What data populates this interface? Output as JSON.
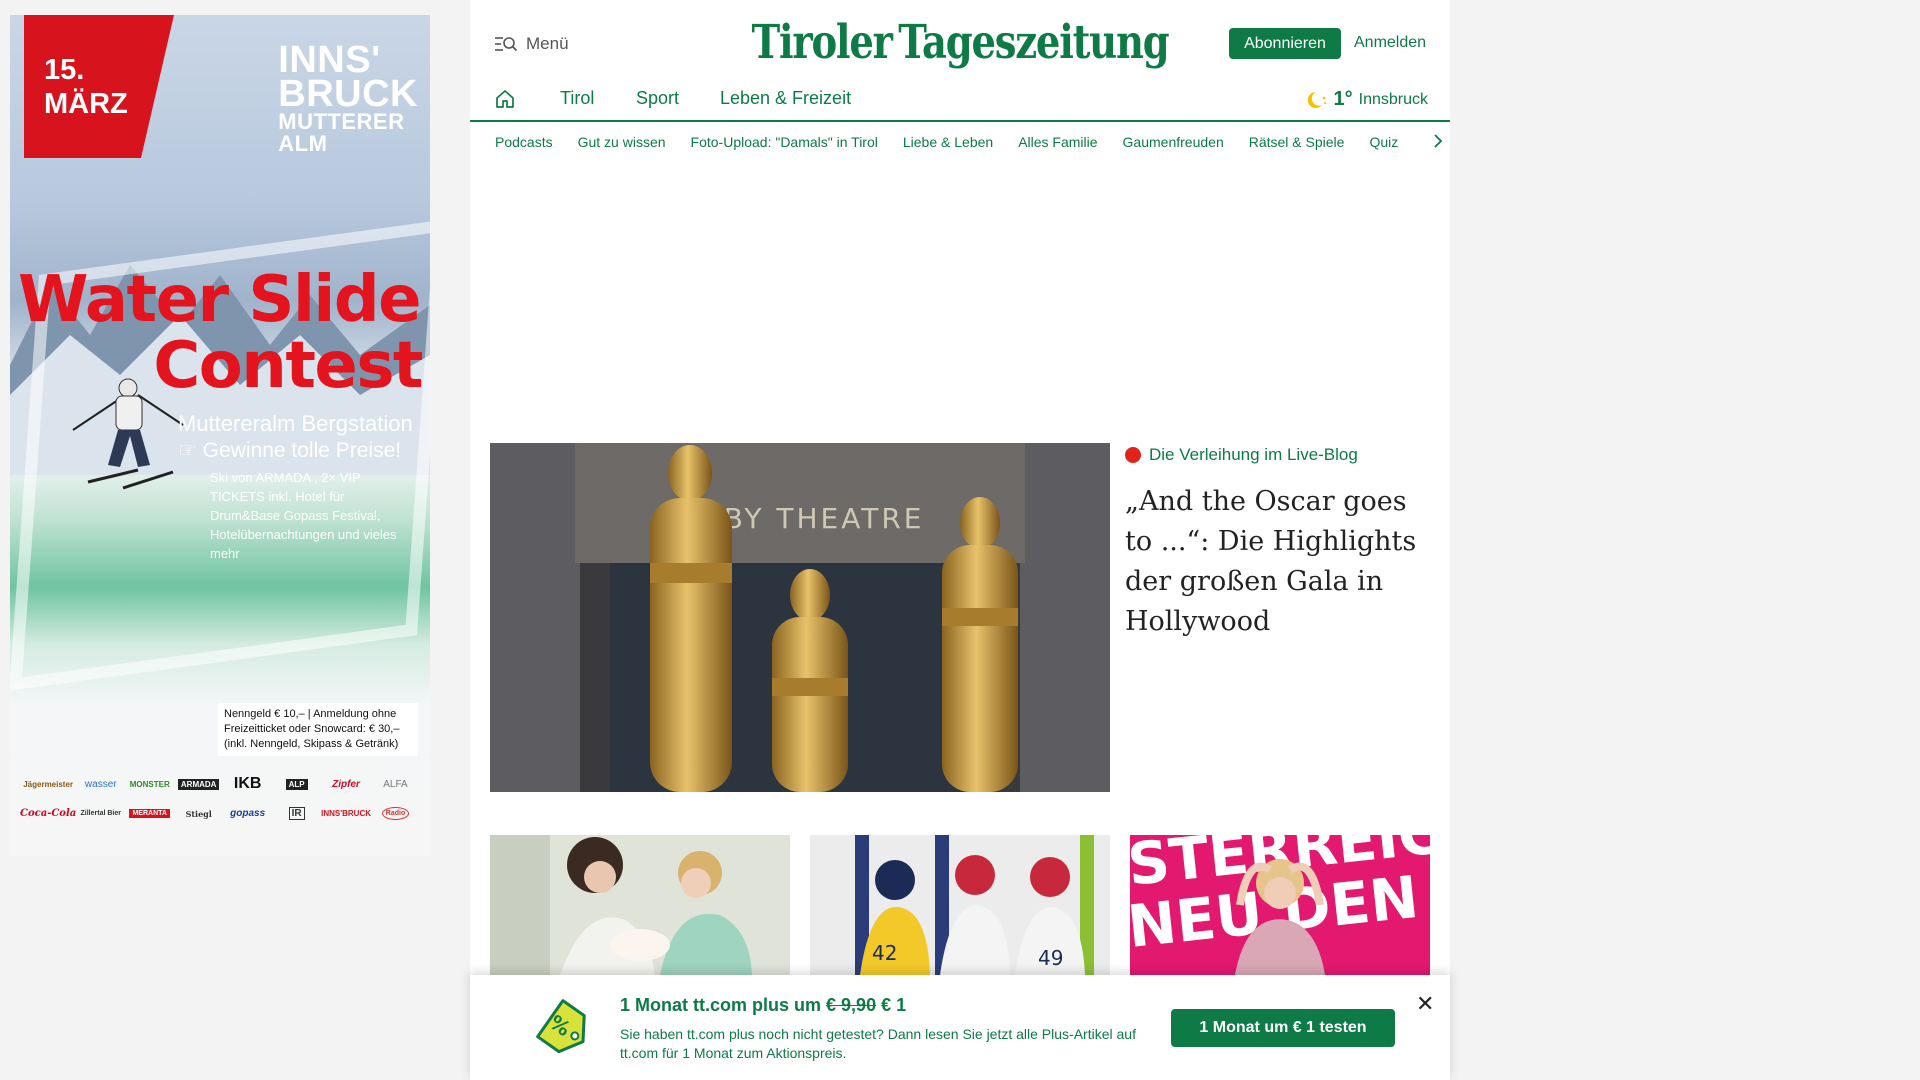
{
  "ad": {
    "date": "15. MÄRZ",
    "brand_line1": "INNS'",
    "brand_line2": "BRUCK",
    "brand_line3": "MUTTERER",
    "brand_line4": "ALM",
    "title_line1": "Water Slide",
    "title_line2": "Contest",
    "subtitle1": "Muttereralm Bergstation",
    "subtitle2": "Gewinne tolle Preise!",
    "details": "Ski von ARMADA , 2× VIP TICKETS inkl. Hotel für Drum&Base Gopass Festival, Hotelübernachtungen und vieles mehr",
    "fee_box": "Nenngeld € 10,– | Anmeldung ohne Freizeitticket oder Snowcard: € 30,– (inkl. Nenngeld, Skipass & Getränk)",
    "sponsors": [
      "Jägermeister",
      "wasser",
      "MONSTER",
      "ARMADA",
      "IKB",
      "ALP",
      "Zipfer",
      "ALFA",
      "Coca-Cola",
      "Zillertal Bier",
      "MERANTA",
      "Stiegl",
      "gopass",
      "IR",
      "INNS'BRUCK",
      "Radio"
    ]
  },
  "header": {
    "menu_label": "Menü",
    "logo_part1": "Tiroler",
    "logo_part2": "Tageszeitung",
    "subscribe_label": "Abonnieren",
    "login_label": "Anmelden"
  },
  "nav": {
    "items": [
      "Tirol",
      "Sport",
      "Leben & Freizeit"
    ],
    "weather_temp": "1°",
    "weather_city": "Innsbruck"
  },
  "subnav": {
    "items": [
      "Podcasts",
      "Gut zu wissen",
      "Foto-Upload: \"Damals\" in Tirol",
      "Liebe & Leben",
      "Alles Familie",
      "Gaumenfreuden",
      "Rätsel & Spiele",
      "Quiz"
    ]
  },
  "hero": {
    "kicker": "Die Verleihung im Live-Blog",
    "title": "„And the Oscar goes to ...“: Die Highlights der großen Gala in Hollywood",
    "image_sign": "DOLBY THEATRE"
  },
  "promo": {
    "title_prefix": "1 Monat tt.com plus um",
    "old_price": "€ 9,90",
    "new_price": "€ 1",
    "text": "Sie haben tt.com plus noch nicht getestet? Dann lesen Sie jetzt alle Plus-Artikel auf tt.com für 1 Monat zum Aktionspreis.",
    "button_label": "1 Monat um € 1 testen",
    "close_label": "✕"
  },
  "colors": {
    "brand_green": "#0e7a45",
    "ad_red": "#d7141e",
    "live_red": "#e2231a"
  }
}
